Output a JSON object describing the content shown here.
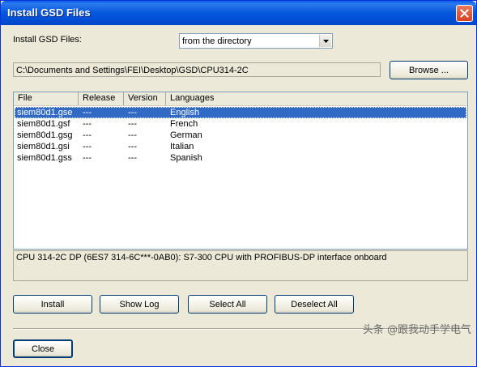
{
  "window": {
    "title": "Install GSD Files"
  },
  "install_from": {
    "label": "Install GSD Files:",
    "selected": "from the directory"
  },
  "path": {
    "value": "C:\\Documents and Settings\\FEI\\Desktop\\GSD\\CPU314-2C"
  },
  "buttons": {
    "browse": "Browse ...",
    "install": "Install",
    "show_log": "Show Log",
    "select_all": "Select All",
    "deselect_all": "Deselect All",
    "close": "Close"
  },
  "list": {
    "columns": [
      "File",
      "Release",
      "Version",
      "Languages"
    ],
    "rows": [
      {
        "file": "siem80d1.gse",
        "release": "---",
        "version": "---",
        "language": "English",
        "selected": true
      },
      {
        "file": "siem80d1.gsf",
        "release": "---",
        "version": "---",
        "language": "French",
        "selected": false
      },
      {
        "file": "siem80d1.gsg",
        "release": "---",
        "version": "---",
        "language": "German",
        "selected": false
      },
      {
        "file": "siem80d1.gsi",
        "release": "---",
        "version": "---",
        "language": "Italian",
        "selected": false
      },
      {
        "file": "siem80d1.gss",
        "release": "---",
        "version": "---",
        "language": "Spanish",
        "selected": false
      }
    ]
  },
  "description": "CPU 314-2C DP (6ES7 314-6C***-0AB0): S7-300 CPU with PROFIBUS-DP interface onboard",
  "watermark": "头条 @跟我动手学电气",
  "colors": {
    "titlebar": "#0558dc",
    "selection": "#316ac5",
    "dialog_bg": "#ece9d8"
  }
}
